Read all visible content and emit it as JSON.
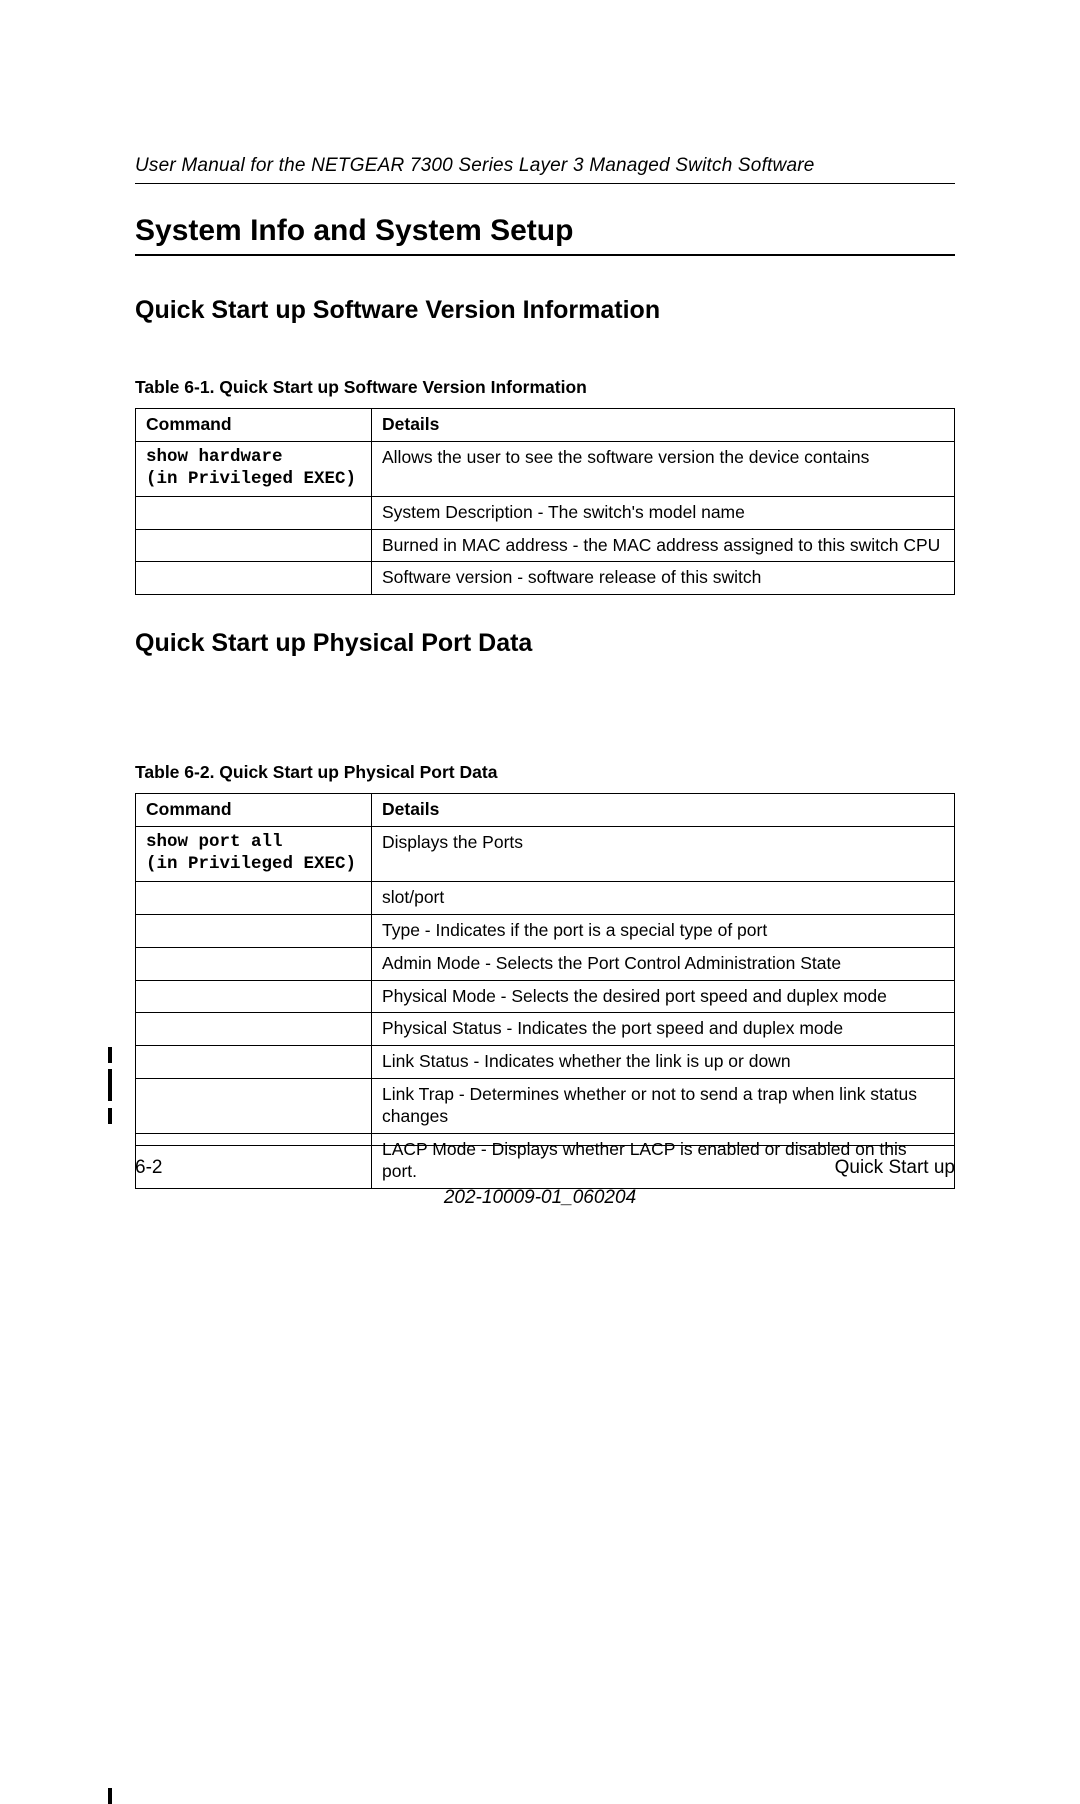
{
  "header": {
    "running_title": "User Manual for the NETGEAR 7300 Series Layer 3 Managed Switch Software"
  },
  "title": "System Info and System Setup",
  "section1": {
    "heading": "Quick Start up Software Version Information",
    "caption": "Table 6-1.      Quick Start up Software Version Information",
    "col_command": "Command",
    "col_details": "Details",
    "rows": [
      {
        "cmd_line1": "show hardware",
        "cmd_line2": "(in Privileged EXEC)",
        "detail": "Allows the user to see the software version the device contains"
      },
      {
        "cmd_line1": "",
        "cmd_line2": "",
        "detail": "System Description - The switch's model name"
      },
      {
        "cmd_line1": "",
        "cmd_line2": "",
        "detail": "Burned in MAC address - the MAC address assigned to this switch CPU"
      },
      {
        "cmd_line1": "",
        "cmd_line2": "",
        "detail": "Software version - software release of this switch"
      }
    ]
  },
  "section2": {
    "heading": "Quick Start up Physical Port Data",
    "caption": "Table 6-2.      Quick Start up Physical Port Data",
    "col_command": "Command",
    "col_details": "Details",
    "rows": [
      {
        "cmd_line1": "show port all",
        "cmd_line2": "(in Privileged EXEC)",
        "detail": "Displays the Ports"
      },
      {
        "cmd_line1": "",
        "cmd_line2": "",
        "detail": "slot/port"
      },
      {
        "cmd_line1": "",
        "cmd_line2": "",
        "detail": "Type - Indicates if the port is a special type of port"
      },
      {
        "cmd_line1": "",
        "cmd_line2": "",
        "detail": "Admin Mode - Selects the Port Control Administration State"
      },
      {
        "cmd_line1": "",
        "cmd_line2": "",
        "detail": "Physical Mode - Selects the desired port speed and duplex mode"
      },
      {
        "cmd_line1": "",
        "cmd_line2": "",
        "detail": "Physical Status - Indicates the port speed and duplex mode"
      },
      {
        "cmd_line1": "",
        "cmd_line2": "",
        "detail": "Link Status - Indicates whether the link is up or down"
      },
      {
        "cmd_line1": "",
        "cmd_line2": "",
        "detail": "Link Trap - Determines whether or not to send a trap when link status changes"
      },
      {
        "cmd_line1": "",
        "cmd_line2": "",
        "detail": "LACP Mode - Displays whether LACP is enabled or disabled on this port."
      }
    ]
  },
  "footer": {
    "page_num": "6-2",
    "chapter": "Quick Start up",
    "doc_number": "202-10009-01_060204"
  }
}
